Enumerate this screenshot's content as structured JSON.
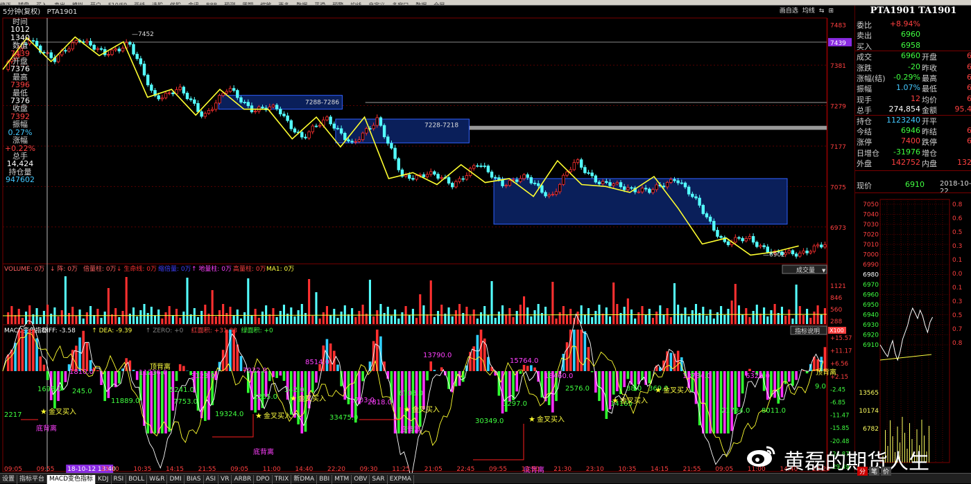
{
  "topmenu": [
    "修正",
    "辅盘",
    "买入",
    "卖出",
    "模拟",
    "开户",
    "F10/F9",
    "画线",
    "选股",
    "优股",
    "金讯",
    "B8B",
    "预测",
    "周期",
    "缩放",
    "更多",
    "数据",
    "平滑",
    "预警",
    "均线",
    "自定义",
    "多窗口",
    "数据",
    "全屏"
  ],
  "title": {
    "period": "5分钟(复权)",
    "symbol": "PTA1901"
  },
  "title_right": [
    "画自选",
    "均线",
    "⇆",
    "⊞"
  ],
  "info_box": [
    {
      "label": "时间",
      "value": "1012",
      "cls": "w"
    },
    {
      "label": "",
      "value": "1340",
      "cls": "w"
    },
    {
      "label": "数值",
      "value": "7439",
      "cls": "r"
    },
    {
      "label": "开盘",
      "value": "7376",
      "cls": "w"
    },
    {
      "label": "最高",
      "value": "7396",
      "cls": "r"
    },
    {
      "label": "最低",
      "value": "7376",
      "cls": "w"
    },
    {
      "label": "收盘",
      "value": "7392",
      "cls": "r"
    },
    {
      "label": "振幅",
      "value": "0.27%",
      "cls": "c"
    },
    {
      "label": "涨幅",
      "value": "+0.22%",
      "cls": "r"
    },
    {
      "label": "总手",
      "value": "14,424",
      "cls": "w"
    },
    {
      "label": "持仓量",
      "value": "947602",
      "cls": "c"
    }
  ],
  "price_axis": {
    "labels": [
      "7483",
      "7439",
      "7381",
      "7279",
      "7177",
      "7075",
      "6973"
    ],
    "highlight": "7439"
  },
  "price_annotations": {
    "high": "7452",
    "low": "6902",
    "box1": "7288-7286",
    "box2": "7228-7218"
  },
  "volume_header": [
    {
      "text": "VOLUME: 0万",
      "color": "#ff6060"
    },
    {
      "text": "↓ 阵: 0万",
      "color": "#ff6060"
    },
    {
      "text": "倍量柱: 0万",
      "color": "#ff6060"
    },
    {
      "text": "↓ 生命线: 0万",
      "color": "#ff3030"
    },
    {
      "text": "缩倍量: 0万",
      "color": "#4040ff"
    },
    {
      "text": "↑ 地量柱: 0万",
      "color": "#ff40ff"
    },
    {
      "text": "高量柱: 0万",
      "color": "#ff4040"
    },
    {
      "text": "MA1: 0万",
      "color": "#ffff40"
    }
  ],
  "volume_axis": [
    "1121",
    "846",
    "560",
    "288"
  ],
  "volume_unit": "X100",
  "volume_dropdown": "成交量",
  "macd_header": [
    {
      "text": "MACD变色指标",
      "color": "#ffffff"
    },
    {
      "text": "DIFF: -3.58",
      "color": "#ffffff"
    },
    {
      "text": "↑ DEA: -9.39",
      "color": "#ffff40"
    },
    {
      "text": "↑ ZERO: +0",
      "color": "#808080"
    },
    {
      "text": "红面积: +31.88",
      "color": "#ff4040"
    },
    {
      "text": "绿面积: +0",
      "color": "#40ff40"
    }
  ],
  "macd_button": "指标说明",
  "macd_axis": [
    "+15.57",
    "+11.17",
    "+6.56",
    "+2.15",
    "-2.45",
    "-6.85",
    "-11.47",
    "-15.85",
    "-20.48",
    "-24.87",
    "-29.49"
  ],
  "macd_labels": [
    {
      "t": "8514.0",
      "c": "#ff40ff"
    },
    {
      "t": "13790.0",
      "c": "#ff40ff"
    },
    {
      "t": "15764.0",
      "c": "#ff40ff"
    },
    {
      "t": "18460.0",
      "c": "#ff40ff"
    },
    {
      "t": "13784.0",
      "c": "#ff40ff"
    },
    {
      "t": "6328.0",
      "c": "#ff40ff"
    },
    {
      "t": "7932.0",
      "c": "#ff40ff"
    },
    {
      "t": "11236.0",
      "c": "#ff40ff"
    },
    {
      "t": "1810.0",
      "c": "#ff40ff"
    },
    {
      "t": "3123.0",
      "c": "#ff40ff"
    },
    {
      "t": "2818.0",
      "c": "#ff40ff"
    },
    {
      "t": "1703.0",
      "c": "#ff40ff"
    },
    {
      "t": "11889.0",
      "c": "#40ff40"
    },
    {
      "t": "1265.0",
      "c": "#40ff40"
    },
    {
      "t": "6703.0",
      "c": "#40ff40"
    },
    {
      "t": "5241.0",
      "c": "#40ff40"
    },
    {
      "t": "7753.0",
      "c": "#40ff40"
    },
    {
      "t": "33475.0",
      "c": "#40ff40"
    },
    {
      "t": "19324.0",
      "c": "#40ff40"
    },
    {
      "t": "30349.0",
      "c": "#40ff40"
    },
    {
      "t": "21734.0",
      "c": "#40ff40"
    },
    {
      "t": "8011.0",
      "c": "#40ff40"
    },
    {
      "t": "2217",
      "c": "#40ff40"
    },
    {
      "t": "1695.0",
      "c": "#40ff40"
    },
    {
      "t": "245.0",
      "c": "#40ff40"
    },
    {
      "t": "342.0",
      "c": "#40ff40"
    },
    {
      "t": "3297.0",
      "c": "#40ff40"
    },
    {
      "t": "2576.0",
      "c": "#40ff40"
    },
    {
      "t": "14165",
      "c": "#40ff40"
    },
    {
      "t": "369.0",
      "c": "#40ff40"
    },
    {
      "t": "88.0",
      "c": "#40ff40"
    },
    {
      "t": "9.0",
      "c": "#40ff40"
    }
  ],
  "buy_signal": "金叉买入",
  "divergence_label": "底背离",
  "top_divergence": "顶背离",
  "time_axis": [
    "09:05",
    "09:55",
    "18-10-12 13:40",
    "23:10",
    "10:35",
    "14:15",
    "21:55",
    "09:05",
    "11:00",
    "14:40",
    "22:20",
    "09:30",
    "11:25",
    "21:05",
    "22:45",
    "09:55",
    "13:50",
    "21:30",
    "23:10",
    "10:35",
    "14:15",
    "21:55",
    "09:05",
    "11:00",
    "14:40",
    "22:20"
  ],
  "time_highlight": "18-10-12 13:40",
  "quote": {
    "title": "PTA1901 TA1901",
    "rows": [
      {
        "k": "委比",
        "v": "+8.94%",
        "vc": "#ff4040",
        "k2": "",
        "v2": ""
      },
      {
        "k": "卖出",
        "v": "6960",
        "vc": "#40ff40",
        "k2": "",
        "v2": ""
      },
      {
        "k": "买入",
        "v": "6958",
        "vc": "#40ff40",
        "k2": "",
        "v2": ""
      },
      {
        "k": "成交",
        "v": "6960",
        "vc": "#40ff40",
        "k2": "开盘",
        "v2": "6"
      },
      {
        "k": "涨跌",
        "v": "-20",
        "vc": "#40ff40",
        "k2": "昨收",
        "v2": "6"
      },
      {
        "k": "涨幅(结)",
        "v": "-0.29%",
        "vc": "#40ff40",
        "k2": "最高",
        "v2": "6"
      },
      {
        "k": "振幅",
        "v": "1.07%",
        "vc": "#44c8ff",
        "k2": "最低",
        "v2": "6"
      },
      {
        "k": "现手",
        "v": "12",
        "vc": "#ff4040",
        "k2": "均价",
        "v2": "6"
      },
      {
        "k": "总手",
        "v": "274,854",
        "vc": "#ffffff",
        "k2": "金额",
        "v2": "95.4"
      },
      {
        "k": "持仓",
        "v": "1123240",
        "vc": "#44c8ff",
        "k2": "开平",
        "v2": ""
      },
      {
        "k": "今结",
        "v": "6946",
        "vc": "#40ff40",
        "k2": "昨结",
        "v2": "6"
      },
      {
        "k": "涨停",
        "v": "7400",
        "vc": "#ff4040",
        "k2": "跌停",
        "v2": "6"
      },
      {
        "k": "日增仓",
        "v": "-31976",
        "vc": "#40ff40",
        "k2": "增仓",
        "v2": ""
      },
      {
        "k": "外盘",
        "v": "142752",
        "vc": "#ff4040",
        "k2": "内盘",
        "v2": "132"
      }
    ],
    "now_label": "现价",
    "now_value": "6910",
    "now_date": "2018-10-22",
    "mini_axis": [
      "7050",
      "7040",
      "7030",
      "7020",
      "7010",
      "7000",
      "6990",
      "6980",
      "6970",
      "6960",
      "6950",
      "6940",
      "6930",
      "6920",
      "6910",
      "13565",
      "10174",
      "6782"
    ],
    "mini_axis_right": [
      "0.8",
      "0.6",
      "0.5",
      "0.3",
      "0.1",
      "0.0",
      "0.1",
      "0.3",
      "0.5",
      "0.7",
      "0.8"
    ],
    "tabs": [
      "分",
      "笔",
      "价"
    ]
  },
  "bottom_tabs": [
    "设置",
    "指标平台",
    "MACD变色指标",
    "KDJ",
    "RSI",
    "BOLL",
    "W&R",
    "DMI",
    "BIAS",
    "ASI",
    "VR",
    "ARBR",
    "DPO",
    "TRIX",
    "新DMA",
    "BBI",
    "MTM",
    "OBV",
    "SAR",
    "EXPMA"
  ],
  "bottom_active": "MACD变色指标",
  "watermark": "黄磊的期货人生",
  "chart_data": {
    "type": "candlestick",
    "symbol": "PTA1901",
    "period": "5分钟",
    "ylim": [
      6880,
      7500
    ],
    "zigzag": [
      7370,
      7450,
      7390,
      7452,
      7405,
      7440,
      7300,
      7320,
      7255,
      7320,
      7270,
      7270,
      7195,
      7250,
      7175,
      7250,
      7095,
      7110,
      7080,
      7130,
      7085,
      7095,
      7050,
      7140,
      7080,
      7075,
      7060,
      7100,
      7020,
      6930,
      6945,
      6902,
      6910,
      6925
    ],
    "ranges": [
      {
        "name": "7288-7286",
        "low": 7286,
        "high": 7288
      },
      {
        "name": "7228-7218",
        "low": 7218,
        "high": 7228
      }
    ],
    "boxes": [
      {
        "x0": 0.262,
        "x1": 0.412,
        "low": 7270,
        "high": 7305
      },
      {
        "x0": 0.404,
        "x1": 0.566,
        "low": 7185,
        "high": 7245
      },
      {
        "x0": 0.596,
        "x1": 0.952,
        "low": 6980,
        "high": 7095
      }
    ]
  }
}
